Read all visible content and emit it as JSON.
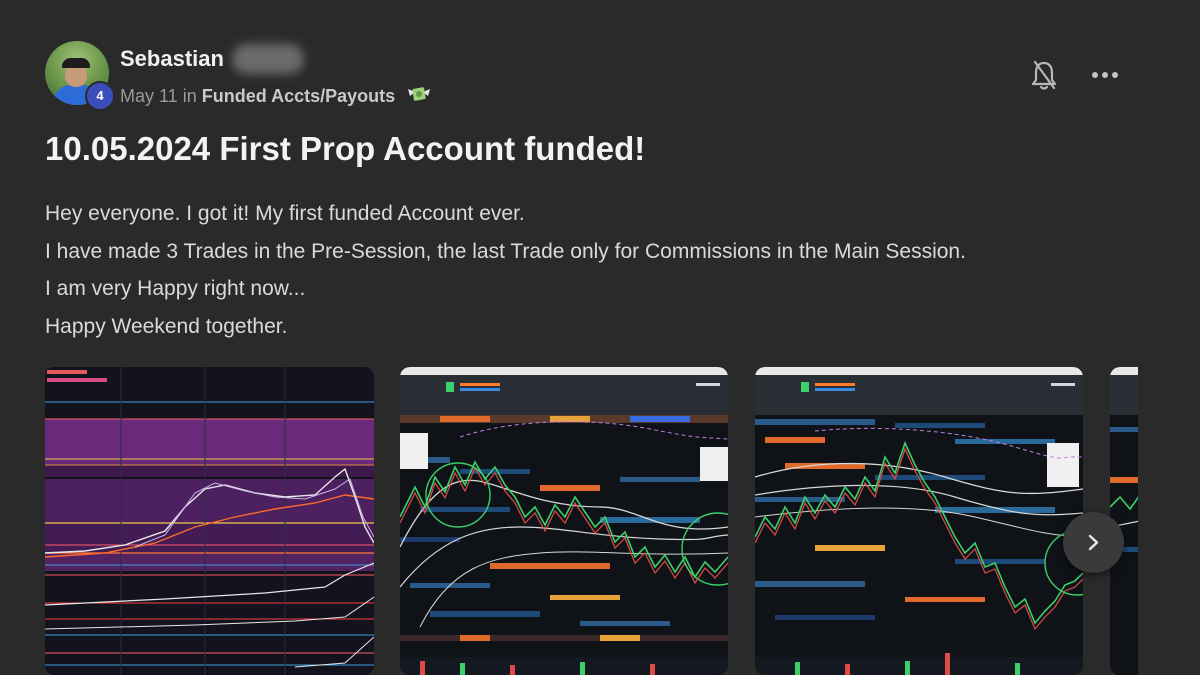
{
  "post": {
    "author_name": "Sebastian",
    "level": "4",
    "date": "May 11",
    "in_label": "in",
    "category": "Funded Accts/Payouts",
    "category_emoji": "💸",
    "title": "10.05.2024 First Prop Account funded!",
    "body_lines": [
      "Hey everyone. I got it! My first funded Account ever.",
      "I have made 3 Trades in the Pre-Session, the last Trade only for Commissions in the Main Session.",
      "I am very Happy right now...",
      "Happy Weekend together."
    ]
  },
  "icons": {
    "notification": "bell-off-icon",
    "more": "more-horizontal-icon",
    "next": "chevron-right-icon"
  },
  "colors": {
    "background": "#2a2a2a",
    "level_badge": "#3b4db8"
  }
}
